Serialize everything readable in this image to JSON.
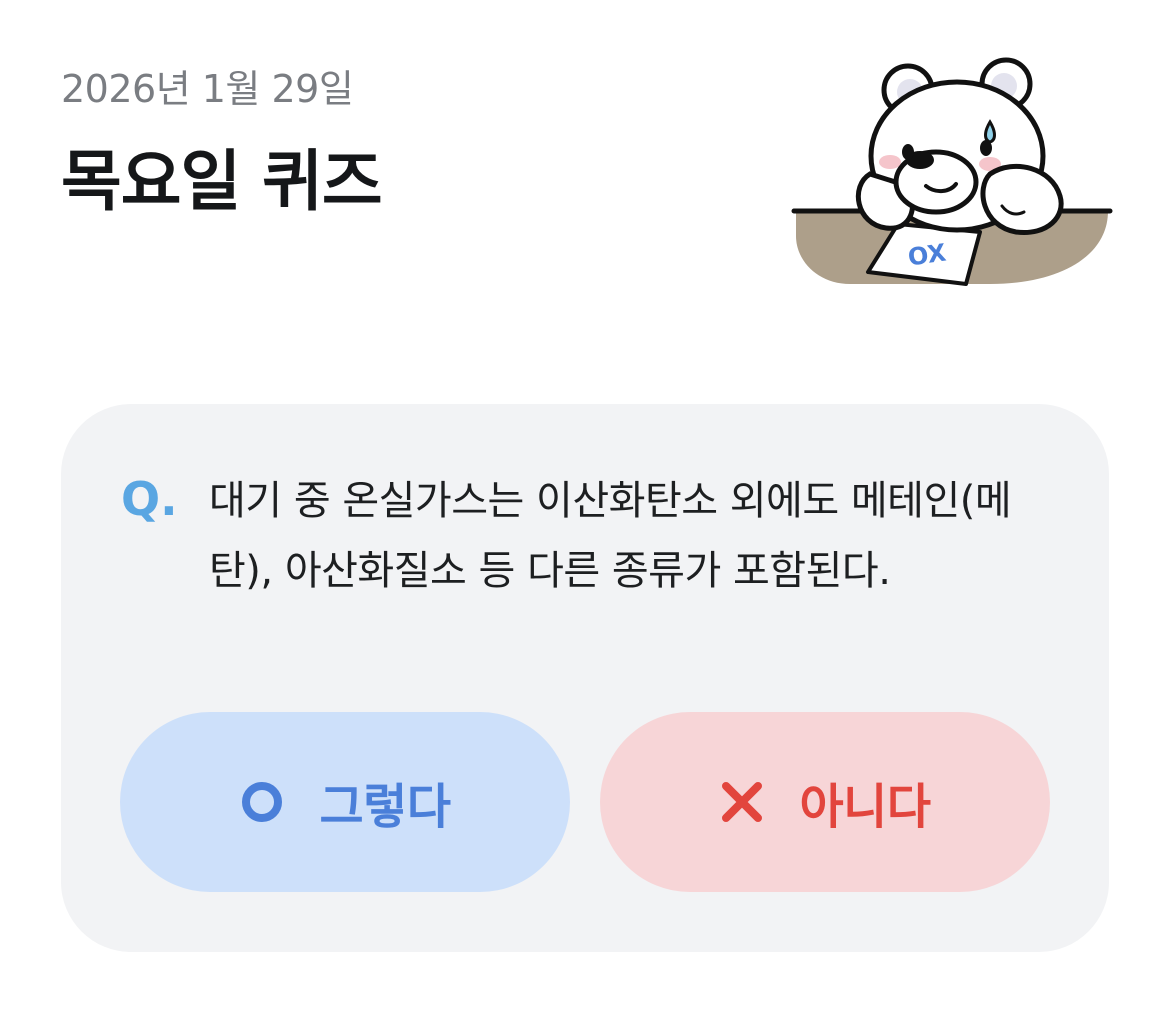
{
  "header": {
    "date": "2026년 1월 29일",
    "title": "목요일 퀴즈"
  },
  "mascot": {
    "icon": "bear-thinking-mascot",
    "card_text": "OX"
  },
  "quiz": {
    "q_mark": "Q.",
    "question": "대기 중 온실가스는 이산화탄소 외에도 메테인(메탄), 아산화질소 등 다른 종류가 포함된다.",
    "answers": [
      {
        "icon": "circle-o-icon",
        "label": "그렇다",
        "color": "#4a7fd9",
        "background": "#cde0fa"
      },
      {
        "icon": "x-mark-icon",
        "label": "아니다",
        "color": "#e2453d",
        "background": "#f7d5d7"
      }
    ]
  },
  "colors": {
    "q_mark": "#5aa6e2",
    "card_background": "#f2f3f5"
  }
}
